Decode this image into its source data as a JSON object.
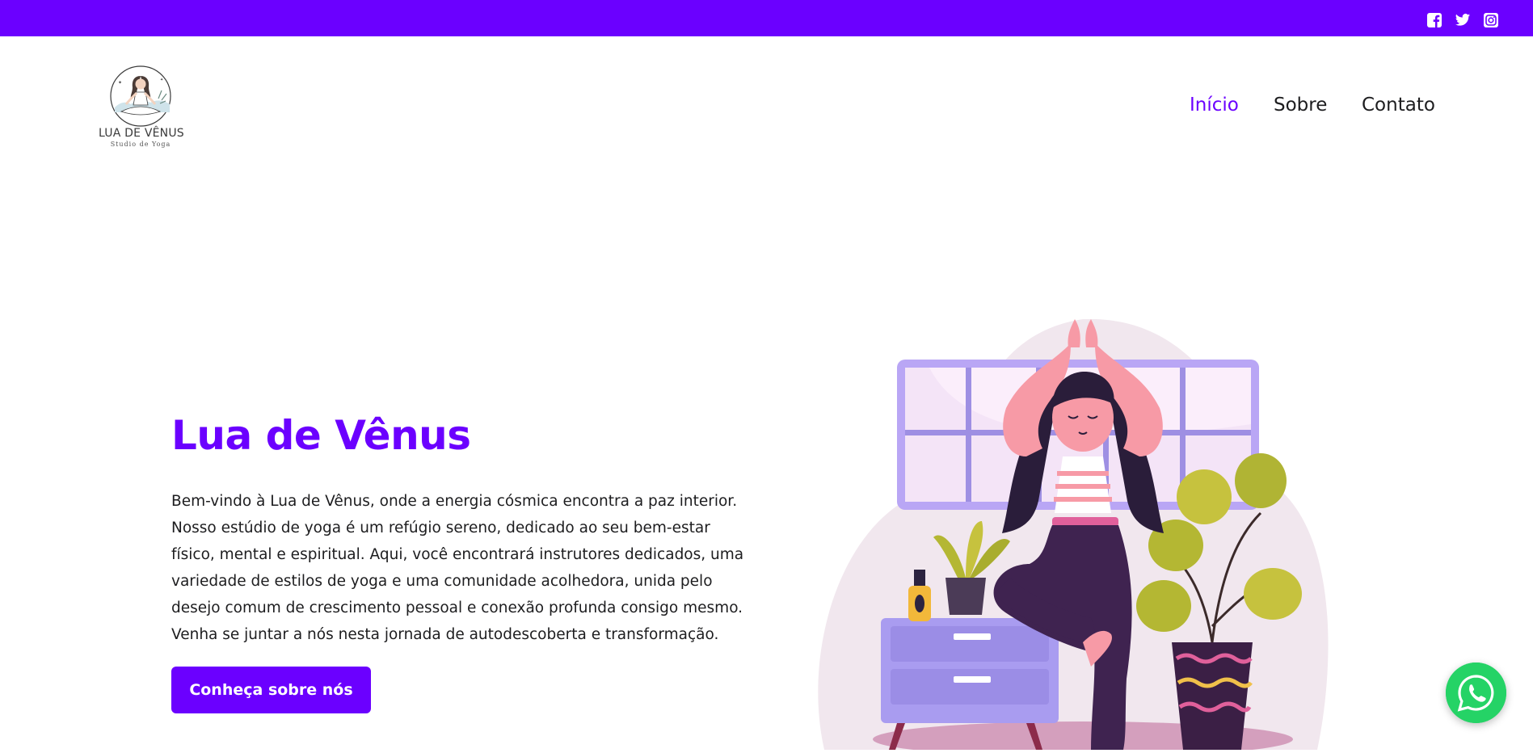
{
  "topbar": {
    "color": "#6b00ff",
    "social": [
      {
        "icon": "facebook-icon"
      },
      {
        "icon": "twitter-icon"
      },
      {
        "icon": "instagram-icon"
      }
    ]
  },
  "logo": {
    "name": "LUA DE VÊNUS",
    "subtitle": "Studio de Yoga"
  },
  "nav": {
    "items": [
      {
        "label": "Início",
        "active": true
      },
      {
        "label": "Sobre",
        "active": false
      },
      {
        "label": "Contato",
        "active": false
      }
    ]
  },
  "hero": {
    "title": "Lua de Vênus",
    "text": "Bem-vindo à Lua de Vênus, onde a energia cósmica encontra a paz interior. Nosso estúdio de yoga é um refúgio sereno, dedicado ao seu bem-estar físico, mental e espiritual. Aqui, você encontrará instrutores dedicados, uma variedade de estilos de yoga e uma comunidade acolhedora, unida pelo desejo comum de crescimento pessoal e conexão profunda consigo mesmo. Venha se juntar a nós nesta jornada de autodescoberta e transformação.",
    "button_label": "Conheça sobre nós"
  },
  "floating": {
    "icon": "whatsapp-icon"
  },
  "colors": {
    "accent": "#6b00ff",
    "whatsapp": "#25d366"
  }
}
